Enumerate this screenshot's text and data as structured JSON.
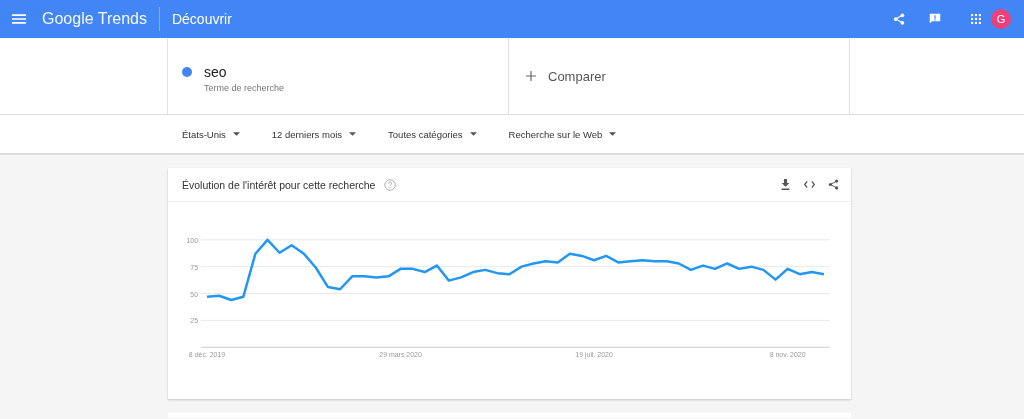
{
  "header": {
    "logo": "Google Trends",
    "page_title": "Découvrir",
    "avatar": "G"
  },
  "search_term": {
    "term": "seo",
    "subtitle": "Terme de recherche",
    "color": "#4285f4"
  },
  "compare": {
    "label": "Comparer"
  },
  "filters": [
    {
      "label": "États-Unis"
    },
    {
      "label": "12 derniers mois"
    },
    {
      "label": "Toutes catégories"
    },
    {
      "label": "Recherche sur le Web"
    }
  ],
  "interest_card": {
    "title": "Évolution de l'intérêt pour cette recherche",
    "chart_data": {
      "type": "line",
      "categories": [
        "8 déc. 2019",
        null,
        null,
        null,
        null,
        null,
        null,
        null,
        null,
        null,
        null,
        null,
        null,
        null,
        null,
        null,
        "29 mars 2020",
        null,
        null,
        null,
        null,
        null,
        null,
        null,
        null,
        null,
        null,
        null,
        null,
        null,
        null,
        null,
        "19 juil. 2020",
        null,
        null,
        null,
        null,
        null,
        null,
        null,
        null,
        null,
        null,
        null,
        null,
        null,
        null,
        null,
        "8 nov. 2020",
        null,
        null,
        null
      ],
      "series": [
        {
          "color": "#2196f3",
          "values": [
            47,
            48,
            44,
            47,
            87,
            100,
            88,
            95,
            87,
            74,
            56,
            54,
            66,
            66,
            65,
            66,
            73,
            73,
            70,
            76,
            62,
            65,
            70,
            72,
            69,
            68,
            75,
            78,
            80,
            79,
            87,
            85,
            81,
            85,
            79,
            80,
            81,
            80,
            80,
            78,
            72,
            76,
            73,
            78,
            73,
            75,
            72,
            63,
            73,
            68,
            70,
            68
          ]
        }
      ],
      "ylim": [
        0,
        100
      ],
      "yticks": [
        25,
        50,
        75,
        100
      ],
      "grid": true
    }
  }
}
